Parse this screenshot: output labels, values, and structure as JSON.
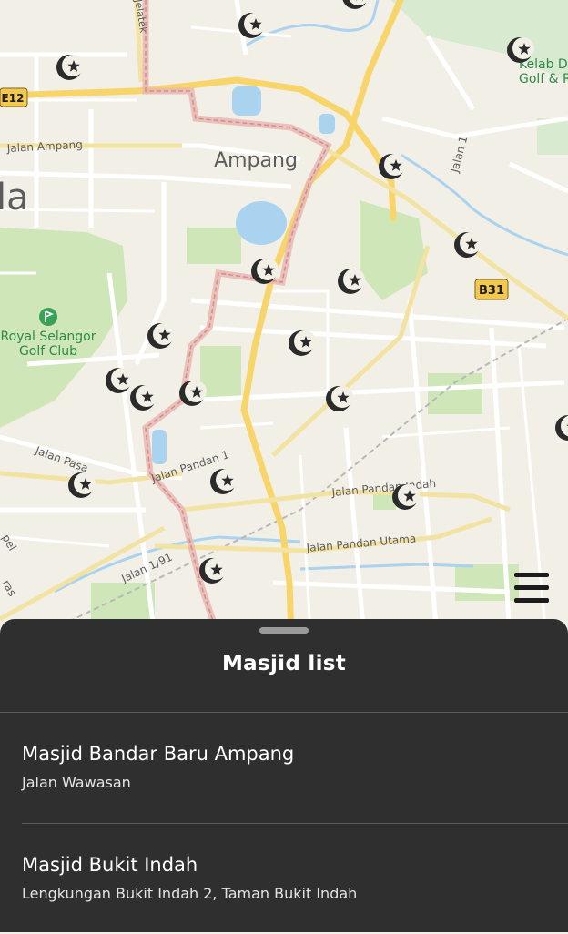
{
  "map": {
    "area_label": "Ampang",
    "partial_label": "la",
    "golf_label_1": "Royal Selangor",
    "golf_label_2": "Golf Club",
    "club_label_1": "Kelab Da",
    "club_label_2": "Golf & R",
    "shields": {
      "e12": "E12",
      "b31": "B31"
    },
    "roads": {
      "jalan_ampang": "Jalan Ampang",
      "jelatek": "Jelatek",
      "jalan_1": "Jalan 1",
      "jalan_pasa": "Jalan Pasa",
      "jalan_pandan_1": "Jalan Pandan 1",
      "jalan_pandan_indah": "Jalan Pandan Indah",
      "jalan_pandan_utama": "Jalan Pandan Utama",
      "jalan_1_91": "Jalan 1/91",
      "ras": "ras",
      "pel": "pel"
    },
    "pin_icon": "mosque-crescent-star-icon",
    "colors": {
      "land": "#f2efe6",
      "park": "#cfe6b8",
      "water": "#a9d3ee",
      "highway": "#f7d56a",
      "route": "#e8b7b3",
      "pin": "#2b2b2b"
    }
  },
  "menu": {
    "icon": "hamburger-menu-icon"
  },
  "sheet": {
    "title": "Masjid list",
    "items": [
      {
        "name": "Masjid Bandar Baru Ampang",
        "address": "Jalan Wawasan"
      },
      {
        "name": "Masjid Bukit Indah",
        "address": "Lengkungan Bukit Indah 2, Taman Bukit Indah"
      }
    ]
  }
}
